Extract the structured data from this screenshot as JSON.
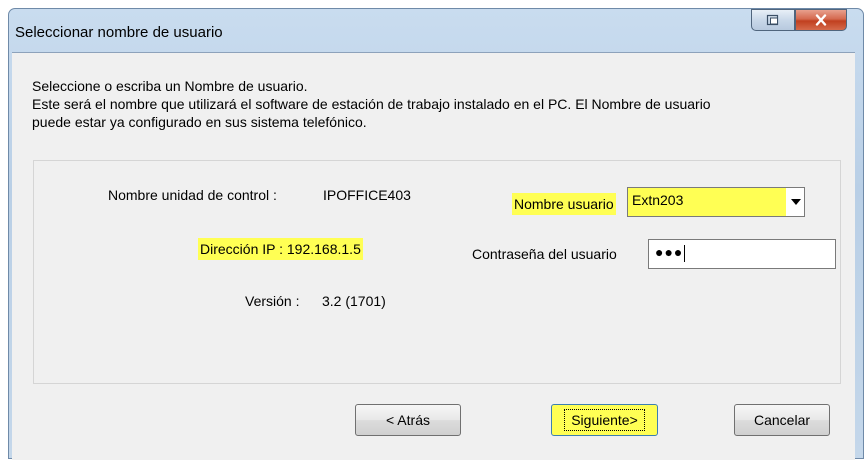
{
  "window": {
    "title": "Seleccionar nombre de usuario"
  },
  "intro": {
    "text": "Seleccione o escriba un Nombre de usuario.\n Este será el nombre que utilizará el software de estación de trabajo instalado en el PC. El Nombre de usuario\npuede estar ya configurado en sus sistema telefónico."
  },
  "info": {
    "control_unit_label": "Nombre unidad de control :",
    "control_unit_value": "IPOFFICE403",
    "ip_label": "Dirección IP :",
    "ip_value": "192.168.1.5",
    "version_label": "Versión :",
    "version_value": "3.2 (1701)"
  },
  "form": {
    "username_label": "Nombre usuario",
    "username_value": "Extn203",
    "password_label": "Contraseña del usuario",
    "password_mask": "●●●"
  },
  "buttons": {
    "back": "< Atrás",
    "next": "Siguiente>",
    "cancel": "Cancelar"
  },
  "colors": {
    "highlight": "#ffff54",
    "title_bar": "#c9dcef",
    "close_button": "#c1401f",
    "dialog_bg": "#f0f0f0"
  },
  "icons": {
    "restore": "restore-icon",
    "close": "close-icon",
    "dropdown": "chevron-down-icon"
  }
}
